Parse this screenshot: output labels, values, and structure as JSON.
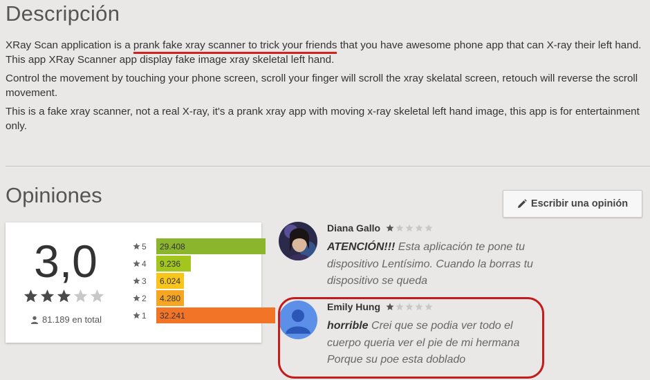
{
  "description": {
    "title": "Descripción",
    "p1_before": "XRay Scan application is a ",
    "p1_underlined": "prank fake xray scanner to trick your friends",
    "p1_after": " that you have awesome phone app that can X-ray their left hand. This app XRay Scanner app display fake image xray skeletal left hand.",
    "p2": "Control the movement by touching your phone screen, scroll your finger will scroll the xray skelatal screen, retouch will reverse the scroll movement.",
    "p3": "This is a fake xray scanner, not a real X-ray, it's a prank xray app with moving x-ray skeletal left hand image, this app is for entertainment only."
  },
  "opinions": {
    "title": "Opiniones",
    "write_button": "Escribir una opinión",
    "icon": "pencil-icon"
  },
  "rating": {
    "score": "3,0",
    "stars_filled": 3,
    "stars_total": 5,
    "total": "81.189 en total",
    "bars": [
      {
        "stars": "5",
        "count": "29.408",
        "fraction": 0.92,
        "color": "#8bb52c"
      },
      {
        "stars": "4",
        "count": "9.236",
        "fraction": 0.29,
        "color": "#a3c61f"
      },
      {
        "stars": "3",
        "count": "6.024",
        "fraction": 0.19,
        "color": "#f7c51c"
      },
      {
        "stars": "2",
        "count": "4.280",
        "fraction": 0.14,
        "color": "#f5a623"
      },
      {
        "stars": "1",
        "count": "32.241",
        "fraction": 1.0,
        "color": "#f27427"
      }
    ]
  },
  "reviews": [
    {
      "name": "Diana Gallo",
      "stars": 1,
      "headline": "ATENCIÓN!!!",
      "text": " Esta aplicación te pone tu dispositivo Lentísimo. Cuando la borras tu dispositivo se queda"
    },
    {
      "name": "Emily Hung",
      "stars": 1,
      "headline": "horrible",
      "text": " Crei que se podia ver todo el cuerpo queria ver el pie de mi hermana Porque su poe esta doblado"
    }
  ]
}
